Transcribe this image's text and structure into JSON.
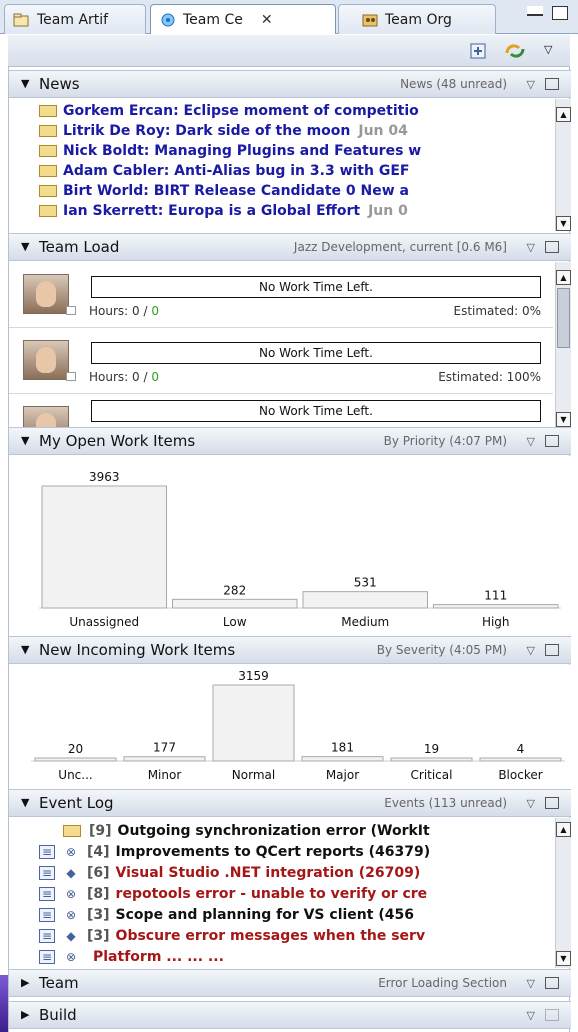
{
  "tabs": [
    {
      "label": "Team Artif"
    },
    {
      "label": "Team Ce"
    },
    {
      "label": "Team Org"
    }
  ],
  "news": {
    "title": "News",
    "subtitle": "News (48 unread)",
    "items": [
      {
        "text": "Gorkem Ercan: Eclipse moment of competitio",
        "date": ""
      },
      {
        "text": "Litrik De Roy: Dark side of the moon",
        "date": "Jun 04"
      },
      {
        "text": "Nick Boldt: Managing Plugins and Features w",
        "date": ""
      },
      {
        "text": "Adam Cabler: Anti-Alias bug in 3.3 with GEF",
        "date": ""
      },
      {
        "text": "Birt World: BIRT Release Candidate 0 New a",
        "date": ""
      },
      {
        "text": "Ian Skerrett: Europa is a Global Effort",
        "date": "Jun 0"
      }
    ]
  },
  "team_load": {
    "title": "Team Load",
    "subtitle": "Jazz Development, current [0.6 M6]",
    "members": [
      {
        "bar": "No Work Time Left.",
        "hours_label": "Hours: 0 /",
        "hours_value": "0",
        "estimated": "Estimated: 0%"
      },
      {
        "bar": "No Work Time Left.",
        "hours_label": "Hours: 0 /",
        "hours_value": "0",
        "estimated": "Estimated: 100%"
      },
      {
        "bar": "No Work Time Left.",
        "hours_label": "",
        "hours_value": "",
        "estimated": ""
      }
    ]
  },
  "open_items": {
    "title": "My Open Work Items",
    "subtitle": "By Priority (4:07 PM)"
  },
  "incoming": {
    "title": "New Incoming Work Items",
    "subtitle": "By Severity (4:05 PM)"
  },
  "chart_data": [
    {
      "type": "bar",
      "categories": [
        "Unassigned",
        "Low",
        "Medium",
        "High"
      ],
      "values": [
        3963,
        282,
        531,
        111
      ],
      "title": "",
      "xlabel": "",
      "ylabel": "",
      "ylim": [
        0,
        3963
      ],
      "bar_color": "#f2f2f2",
      "bar_stroke": "#a9a9a9"
    },
    {
      "type": "bar",
      "categories": [
        "Unc...",
        "Minor",
        "Normal",
        "Major",
        "Critical",
        "Blocker"
      ],
      "values": [
        20,
        177,
        3159,
        181,
        19,
        4
      ],
      "title": "",
      "xlabel": "",
      "ylabel": "",
      "ylim": [
        0,
        3159
      ],
      "bar_color": "#f2f2f2",
      "bar_stroke": "#a9a9a9"
    }
  ],
  "event_log": {
    "title": "Event Log",
    "subtitle": "Events (113 unread)",
    "items": [
      {
        "icon": "feed-icon",
        "num": "[9]",
        "text": "Outgoing synchronization error (WorkIt",
        "color": "black"
      },
      {
        "icon": "binoculars-icon",
        "num": "[4]",
        "text": "Improvements to QCert reports (46379)",
        "color": "black"
      },
      {
        "icon": "diamond-icon",
        "num": "[6]",
        "text": "Visual Studio .NET integration (26709)",
        "color": "red"
      },
      {
        "icon": "binoculars-icon",
        "num": "[8]",
        "text": "repotools error - unable to verify or cre",
        "color": "red"
      },
      {
        "icon": "binoculars-icon",
        "num": "[3]",
        "text": "Scope and planning for VS client (456",
        "color": "black"
      },
      {
        "icon": "diamond-icon",
        "num": "[3]",
        "text": "Obscure error messages when the serv",
        "color": "red"
      },
      {
        "icon": "binoculars-icon",
        "num": "",
        "text": "Platform ... ... ...",
        "color": "red"
      }
    ]
  },
  "team": {
    "title": "Team",
    "subtitle": "Error Loading Section"
  },
  "build": {
    "title": "Build"
  },
  "colors": {
    "header_bg": "#d5dde9",
    "link_blue": "#1a1aa6",
    "error_red": "#a51616",
    "accent_purple": "#5b3bb0"
  }
}
